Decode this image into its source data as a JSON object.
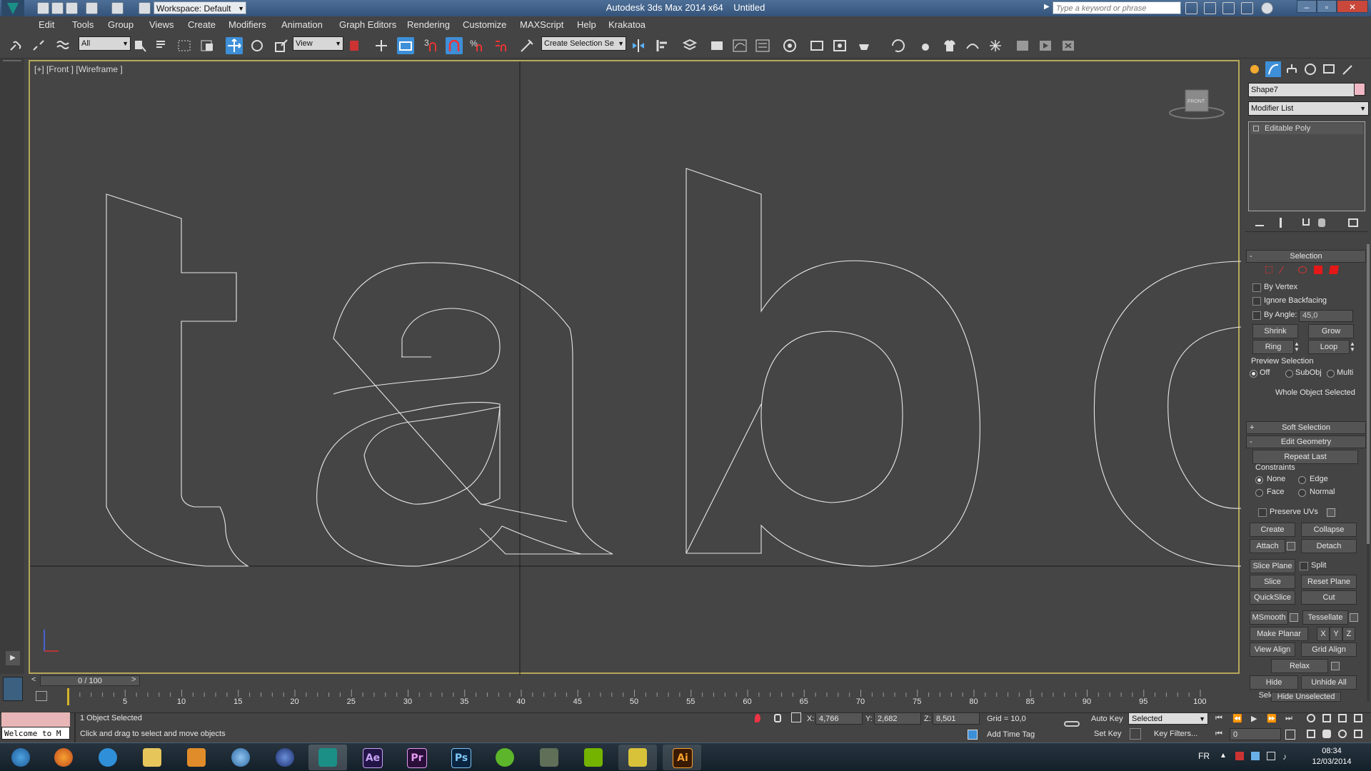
{
  "titlebar": {
    "workspace": "Workspace: Default",
    "app_title": "Autodesk 3ds Max  2014 x64",
    "doc_title": "Untitled",
    "search_placeholder": "Type a keyword or phrase"
  },
  "menu": [
    "Edit",
    "Tools",
    "Group",
    "Views",
    "Create",
    "Modifiers",
    "Animation",
    "Graph Editors",
    "Rendering",
    "Customize",
    "MAXScript",
    "Help",
    "Krakatoa"
  ],
  "toolbar": {
    "filter": "All",
    "ref_coord": "View",
    "named_selection": "Create Selection Se",
    "snap_3": "3"
  },
  "viewport": {
    "label": "[+] [Front ] [Wireframe ]",
    "viewcube_label": "FRONT"
  },
  "command_panel": {
    "object_name": "Shape7",
    "object_color": "#f0b8c4",
    "modifier_list": "Modifier List",
    "stack_item": "Editable Poly",
    "selection": {
      "title": "Selection",
      "by_vertex": "By Vertex",
      "ignore_backfacing": "Ignore Backfacing",
      "by_angle": "By Angle:",
      "angle_value": "45,0",
      "shrink": "Shrink",
      "grow": "Grow",
      "ring": "Ring",
      "loop": "Loop",
      "preview_selection": "Preview Selection",
      "off": "Off",
      "subobj": "SubObj",
      "multi": "Multi",
      "whole_object": "Whole Object Selected"
    },
    "soft_selection": "Soft Selection",
    "edit_geometry": {
      "title": "Edit Geometry",
      "repeat_last": "Repeat Last",
      "constraints": "Constraints",
      "none": "None",
      "edge": "Edge",
      "face": "Face",
      "normal": "Normal",
      "preserve_uvs": "Preserve UVs",
      "create": "Create",
      "collapse": "Collapse",
      "attach": "Attach",
      "detach": "Detach",
      "slice_plane": "Slice Plane",
      "split": "Split",
      "slice": "Slice",
      "reset_plane": "Reset Plane",
      "quickslice": "QuickSlice",
      "cut": "Cut",
      "msmooth": "MSmooth",
      "tessellate": "Tessellate",
      "make_planar": "Make Planar",
      "x": "X",
      "y": "Y",
      "z": "Z",
      "view_align": "View Align",
      "grid_align": "Grid Align",
      "relax": "Relax",
      "hide_selected": "Hide Selected",
      "unhide_all": "Unhide All",
      "hide_unselected": "Hide Unselected"
    }
  },
  "timeline": {
    "frame": "0 / 100",
    "prev": "<",
    "next": ">",
    "ticks": [
      "5",
      "10",
      "15",
      "20",
      "25",
      "30",
      "35",
      "40",
      "45",
      "50",
      "55",
      "60",
      "65",
      "70",
      "75",
      "80",
      "85",
      "90",
      "95",
      "100"
    ]
  },
  "status": {
    "welcome": "Welcome to M",
    "selected": "1 Object Selected",
    "prompt": "Click and drag to select and move objects",
    "x_label": "X:",
    "x": "4,766",
    "y_label": "Y:",
    "y": "2,682",
    "z_label": "Z:",
    "z": "8,501",
    "grid": "Grid = 10,0",
    "add_time_tag": "Add Time Tag",
    "auto_key": "Auto Key",
    "set_key": "Set Key",
    "key_mode": "Selected",
    "key_filters": "Key Filters...",
    "current_frame": "0"
  },
  "taskbar": {
    "apps": [
      {
        "name": "start",
        "label": ""
      },
      {
        "name": "firefox",
        "label": ""
      },
      {
        "name": "metro",
        "label": ""
      },
      {
        "name": "explorer",
        "label": ""
      },
      {
        "name": "media-player",
        "label": ""
      },
      {
        "name": "network",
        "label": ""
      },
      {
        "name": "browser-orb",
        "label": ""
      },
      {
        "name": "3dsmax",
        "label": ""
      },
      {
        "name": "after-effects",
        "label": "Ae"
      },
      {
        "name": "premiere",
        "label": "Pr"
      },
      {
        "name": "photoshop",
        "label": "Ps"
      },
      {
        "name": "utorrent",
        "label": ""
      },
      {
        "name": "tool",
        "label": ""
      },
      {
        "name": "nvidia",
        "label": ""
      },
      {
        "name": "movie-maker",
        "label": ""
      },
      {
        "name": "illustrator",
        "label": "Ai"
      }
    ],
    "lang": "FR",
    "time": "08:34",
    "date": "12/03/2014"
  }
}
